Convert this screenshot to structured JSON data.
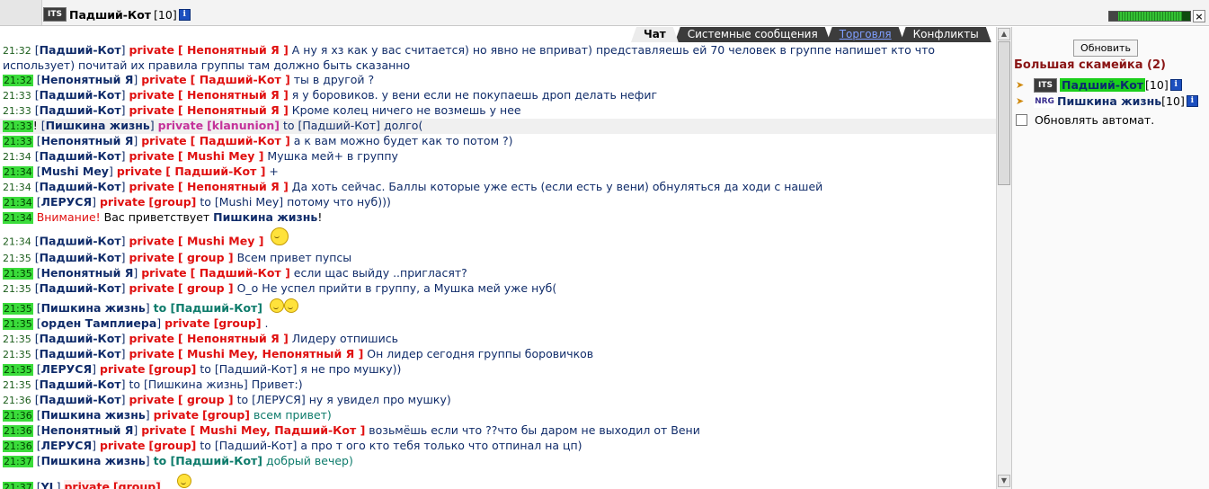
{
  "header": {
    "clan": "ITS",
    "nick": "Падший-Кот",
    "level": "[10]",
    "info": "i",
    "hp_fraction": 0.9,
    "close": "×"
  },
  "tabs": [
    {
      "label": "Чат"
    },
    {
      "label": "Системные сообщения"
    },
    {
      "label": "Торговля"
    },
    {
      "label": "Конфликты"
    }
  ],
  "chat": {
    "lines": [
      {
        "ts": "21:32",
        "from": "Падший-Кот",
        "kind": "private",
        "target": "[ Непонятный Я ]",
        "text": "А ну я хз как у вас считается) но явно не вприват) представляешь ей 70 человек в группе напишет кто что использует) почитай их правила группы там должно быть сказанно"
      },
      {
        "ts": "21:32",
        "from": "Непонятный Я",
        "kind": "private",
        "target": "[ Падший-Кот ]",
        "text": "ты в другой ?"
      },
      {
        "ts": "21:33",
        "from": "Падший-Кот",
        "kind": "private",
        "target": "[ Непонятный Я ]",
        "text": "я у боровиков. у вени если не покупаешь дроп делать нефиг"
      },
      {
        "ts": "21:33",
        "from": "Падший-Кот",
        "kind": "private",
        "target": "[ Непонятный Я ]",
        "text": "Кроме колец ничего не возмешь у нее"
      },
      {
        "ts": "21:33",
        "from": "Пишкина жизнь",
        "kind": "private",
        "target": "[klanunion]",
        "to": "to [Падший-Кот]",
        "text": "долго("
      },
      {
        "ts": "21:33",
        "from": "Непонятный Я",
        "kind": "private",
        "target": "[ Падший-Кот ]",
        "text": "а к вам можно будет как то потом ?)"
      },
      {
        "ts": "21:34",
        "from": "Падший-Кот",
        "kind": "private",
        "target": "[ Mushi Mey ]",
        "text": "Мушка мей+ в группу"
      },
      {
        "ts": "21:34",
        "from": "Mushi Mey",
        "kind": "private",
        "target": "[ Падший-Кот ]",
        "text": "+"
      },
      {
        "ts": "21:34",
        "from": "Падший-Кот",
        "kind": "private",
        "target": "[ Непонятный Я ]",
        "text": "Да хоть сейчас. Баллы которые уже есть (если есть у вени) обнуляться да ходи с нашей"
      },
      {
        "ts": "21:34",
        "from": "ЛЕРУСЯ",
        "kind": "private",
        "target": "[group]",
        "to": "to [Mushi Mey]",
        "text": "потому что нуб)))"
      },
      {
        "ts": "21:34",
        "warn": "Внимание!",
        "text": "Вас приветствует",
        "bold": "Пишкина жизнь",
        "end": "!"
      },
      {
        "ts": "21:34",
        "from": "Падший-Кот",
        "kind": "private",
        "target": "[ Mushi Mey ]",
        "text": ""
      },
      {
        "ts": "21:35",
        "from": "Падший-Кот",
        "kind": "private",
        "target": "[ group ]",
        "text": "Всем привет пупсы"
      },
      {
        "ts": "21:35",
        "from": "Непонятный Я",
        "kind": "private",
        "target": "[ Падший-Кот ]",
        "text": "если щас выйду ..пригласят?"
      },
      {
        "ts": "21:35",
        "from": "Падший-Кот",
        "kind": "private",
        "target": "[ group ]",
        "text": "О_о Не успел прийти в группу, а Мушка мей уже нуб("
      },
      {
        "ts": "21:35",
        "from": "Пишкина жизнь",
        "to_own": "to [Падший-Кот]",
        "text": ""
      },
      {
        "ts": "21:35",
        "from": "орден Тамплиера",
        "kind": "private",
        "target": "[group]",
        "text": "."
      },
      {
        "ts": "21:35",
        "from": "Падший-Кот",
        "kind": "private",
        "target": "[ Непонятный Я ]",
        "text": "Лидеру отпишись"
      },
      {
        "ts": "21:35",
        "from": "Падший-Кот",
        "kind": "private",
        "target": "[ Mushi Mey, Непонятный Я ]",
        "text": "Он лидер сегодня группы боровичков"
      },
      {
        "ts": "21:35",
        "from": "ЛЕРУСЯ",
        "kind": "private",
        "target": "[group]",
        "to": "to [Падший-Кот]",
        "text": "я не про мушку))"
      },
      {
        "ts": "21:35",
        "from": "Падший-Кот",
        "to": "to [Пишкина жизнь]",
        "text": "Привет:)"
      },
      {
        "ts": "21:36",
        "from": "Падший-Кот",
        "kind": "private",
        "target": "[ group ]",
        "to": "to [ЛЕРУСЯ]",
        "text": "ну я увидел про мушку)"
      },
      {
        "ts": "21:36",
        "from": "Пишкина жизнь",
        "kind": "private",
        "target": "[group]",
        "text_teal": "всем привет)"
      },
      {
        "ts": "21:36",
        "from": "Непонятный Я",
        "kind": "private",
        "target": "[ Mushi Mey, Падший-Кот ]",
        "text": "возьмёшь если что ??что бы даром не выходил от Вени"
      },
      {
        "ts": "21:36",
        "from": "ЛЕРУСЯ",
        "kind": "private",
        "target": "[group]",
        "to": "to [Падший-Кот]",
        "text": "а про т ого кто тебя только что отпинал на цп)"
      },
      {
        "ts": "21:37",
        "from": "Пишкина жизнь",
        "to_own": "to [Падший-Кот]",
        "text_teal": "добрый вечер)"
      },
      {
        "ts": "21:37",
        "from": "YL",
        "kind": "private",
        "target": "[group]",
        "text": ""
      }
    ],
    "private_label": "private"
  },
  "sidebar": {
    "refresh_label": "Обновить",
    "bench_title": "Большая скамейка (2)",
    "members": [
      {
        "clan": "ITS",
        "nick": "Падший-Кот",
        "level": "[10]",
        "highlight": true
      },
      {
        "clan": "NRG",
        "nick": "Пишкина жизнь",
        "level": "[10]",
        "highlight": false
      }
    ],
    "autorefresh_label": "Обновлять автомат."
  },
  "colors": {
    "timestamp_highlight": "#3bdc3b",
    "private_red": "#e01010",
    "nick_blue": "#102c6a",
    "teal": "#0d7b6b",
    "bench_title": "#8a1515"
  }
}
